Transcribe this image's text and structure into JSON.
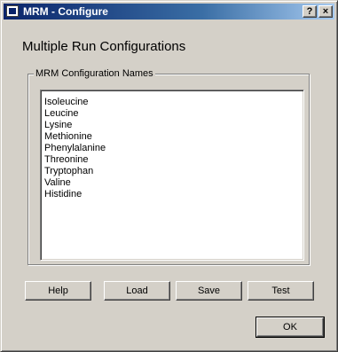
{
  "window": {
    "title": "MRM - Configure",
    "help_caption": "?",
    "close_caption": "×"
  },
  "heading": "Multiple Run Configurations",
  "group": {
    "legend": "MRM Configuration Names",
    "items": [
      "Isoleucine",
      "Leucine",
      "Lysine",
      "Methionine",
      "Phenylalanine",
      "Threonine",
      "Tryptophan",
      "Valine",
      "Histidine"
    ]
  },
  "buttons": {
    "help": "Help",
    "load": "Load",
    "save": "Save",
    "test": "Test",
    "ok": "OK"
  }
}
